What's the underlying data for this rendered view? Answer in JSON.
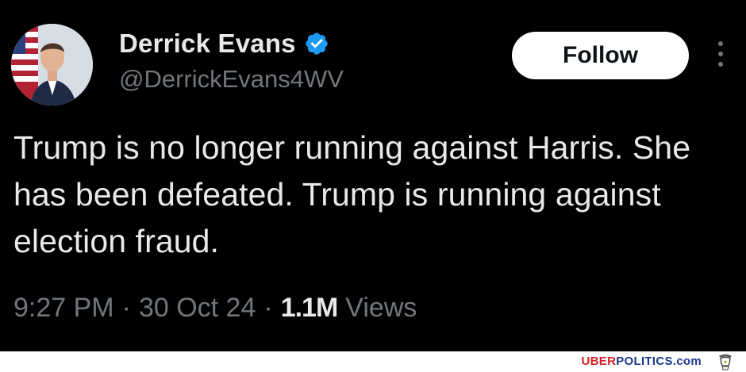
{
  "tweet": {
    "author_name": "Derrick Evans",
    "handle": "@DerrickEvans4WV",
    "follow_label": "Follow",
    "text": "Trump is no longer running against Harris. She has been defeated. Trump is running against election fraud.",
    "time": "9:27 PM",
    "separator": "·",
    "date": "30 Oct 24",
    "views_count": "1.1M",
    "views_label": "Views"
  },
  "watermark": {
    "part1": "UBER",
    "part2": "POLITICS",
    "part3": ".com"
  },
  "colors": {
    "background": "#000000",
    "text": "#e7e9ea",
    "secondary": "#71767b",
    "verified": "#1d9bf0",
    "follow_bg": "#ffffff"
  },
  "icons": [
    "verified-badge-icon",
    "more-options-icon",
    "eagle-logo-icon"
  ]
}
